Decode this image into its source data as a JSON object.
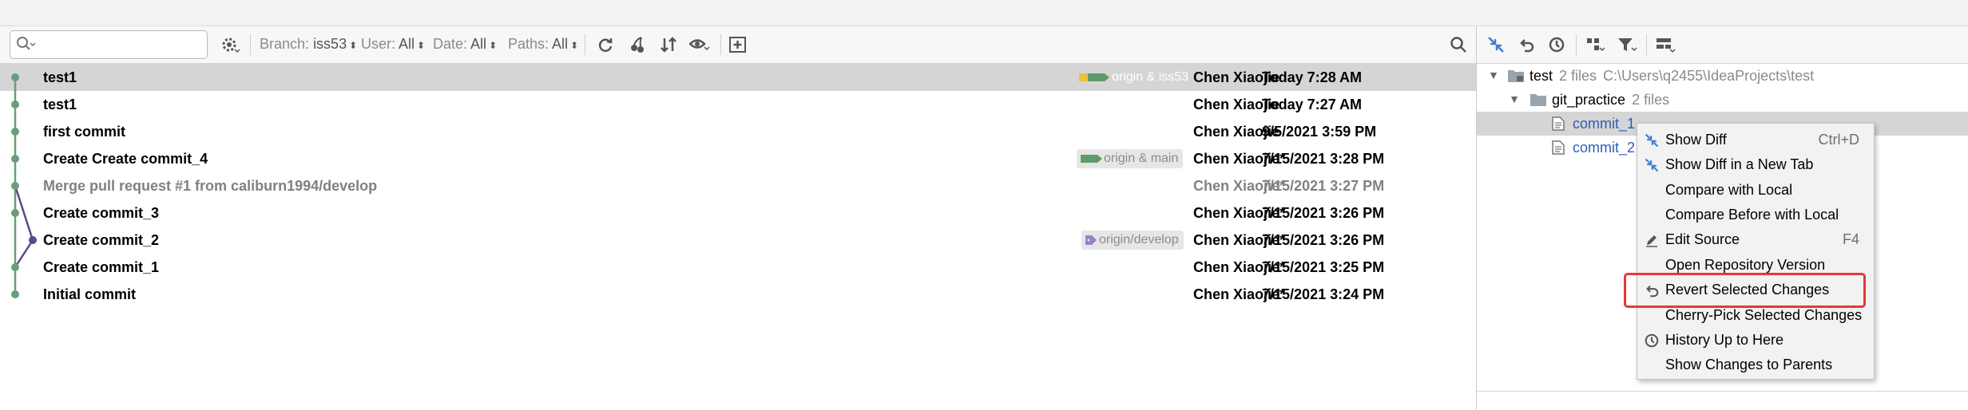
{
  "toolbar": {
    "search_placeholder": "",
    "filters": [
      {
        "label": "Branch:",
        "value": "iss53"
      },
      {
        "label": "User:",
        "value": "All"
      },
      {
        "label": "Date:",
        "value": "All"
      },
      {
        "label": "Paths:",
        "value": "All"
      }
    ]
  },
  "commits": [
    {
      "subject": "test1",
      "author": "Chen Xiaojie",
      "date": "Today 7:28 AM",
      "ref": "origin & iss53"
    },
    {
      "subject": "test1",
      "author": "Chen Xiaojie",
      "date": "Today 7:27 AM",
      "ref": ""
    },
    {
      "subject": "first commit",
      "author": "Chen Xiaojie",
      "date": "9/5/2021 3:59 PM",
      "ref": ""
    },
    {
      "subject": "Create Create commit_4",
      "author": "Chen Xiaojie*",
      "date": "7/15/2021 3:28 PM",
      "ref": "origin & main"
    },
    {
      "subject": "Merge pull request #1 from caliburn1994/develop",
      "author": "Chen Xiaojie*",
      "date": "7/15/2021 3:27 PM",
      "ref": ""
    },
    {
      "subject": "Create commit_3",
      "author": "Chen Xiaojie*",
      "date": "7/15/2021 3:26 PM",
      "ref": ""
    },
    {
      "subject": "Create commit_2",
      "author": "Chen Xiaojie*",
      "date": "7/15/2021 3:26 PM",
      "ref": "origin/develop"
    },
    {
      "subject": "Create commit_1",
      "author": "Chen Xiaojie*",
      "date": "7/15/2021 3:25 PM",
      "ref": ""
    },
    {
      "subject": "Initial commit",
      "author": "Chen Xiaojie*",
      "date": "7/15/2021 3:24 PM",
      "ref": ""
    }
  ],
  "changes_tree": {
    "root": {
      "name": "test",
      "count": "2 files",
      "path": "C:\\Users\\q2455\\IdeaProjects\\test"
    },
    "folder": {
      "name": "git_practice",
      "count": "2 files"
    },
    "files": [
      "commit_1",
      "commit_2"
    ]
  },
  "context_menu": {
    "items": [
      {
        "label": "Show Diff",
        "shortcut": "Ctrl+D",
        "icon": "diff-arrows-icon"
      },
      {
        "label": "Show Diff in a New Tab",
        "shortcut": "",
        "icon": "diff-arrows-icon"
      },
      {
        "label": "Compare with Local",
        "shortcut": "",
        "icon": ""
      },
      {
        "label": "Compare Before with Local",
        "shortcut": "",
        "icon": ""
      },
      {
        "label": "Edit Source",
        "shortcut": "F4",
        "icon": "pencil-icon"
      },
      {
        "label": "Open Repository Version",
        "shortcut": "",
        "icon": ""
      },
      {
        "label": "Revert Selected Changes",
        "shortcut": "",
        "icon": "revert-icon"
      },
      {
        "label": "Cherry-Pick Selected Changes",
        "shortcut": "",
        "icon": ""
      },
      {
        "label": "History Up to Here",
        "shortcut": "",
        "icon": "clock-icon"
      },
      {
        "label": "Show Changes to Parents",
        "shortcut": "",
        "icon": ""
      }
    ]
  },
  "colors": {
    "graph_main": "#6a9e7a",
    "graph_branch": "#5b4a8a",
    "selection": "#d5d5d5",
    "highlight": "#e53935",
    "ref_tag_yellow": "#e8c23a",
    "ref_tag_green": "#5e9b6a",
    "ref_tag_purple": "#9b7fc4"
  }
}
